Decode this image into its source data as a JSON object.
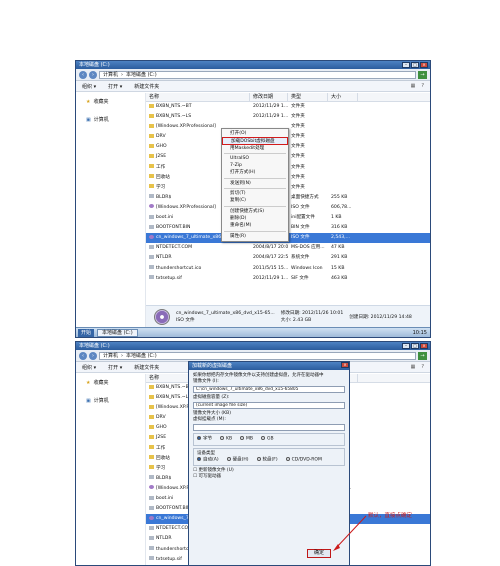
{
  "window": {
    "title": "本地磁盘 (C:)",
    "address": [
      "计算机",
      "本地磁盘 (C:)"
    ],
    "toolbar": [
      "组织 ▾",
      "打开 ▾",
      "新建文件夹"
    ],
    "sidebar": [
      "收藏夹",
      "计算机"
    ],
    "columns": [
      "名称",
      "修改日期",
      "类型",
      "大小"
    ]
  },
  "files": [
    {
      "name": "BXBN_NTS.~BT",
      "date": "2012/11/29 1...",
      "type": "文件夹",
      "size": "",
      "icon": "folder"
    },
    {
      "name": "BXBN_NTS.~LS",
      "date": "2012/11/29 1...",
      "type": "文件夹",
      "size": "",
      "icon": "folder"
    },
    {
      "name": "[Windows.XP.Professional]",
      "date": "",
      "type": "文件夹",
      "size": "",
      "icon": "folder"
    },
    {
      "name": "DRV",
      "date": "",
      "type": "文件夹",
      "size": "",
      "icon": "folder"
    },
    {
      "name": "GHO",
      "date": "",
      "type": "文件夹",
      "size": "",
      "icon": "folder"
    },
    {
      "name": "J2SE",
      "date": "",
      "type": "文件夹",
      "size": "",
      "icon": "folder"
    },
    {
      "name": "工作",
      "date": "",
      "type": "文件夹",
      "size": "",
      "icon": "folder"
    },
    {
      "name": "回收站",
      "date": "",
      "type": "文件夹",
      "size": "",
      "icon": "folder"
    },
    {
      "name": "学习",
      "date": "",
      "type": "文件夹",
      "size": "",
      "icon": "folder"
    },
    {
      "name": "BLDR$",
      "date": "",
      "type": "桌面快捷方式",
      "size": "255 KB",
      "icon": "file"
    },
    {
      "name": "[Windows.XP.Professional]",
      "date": "",
      "type": "ISO 文件",
      "size": "606,78...",
      "icon": "iso"
    },
    {
      "name": "boot.ini",
      "date": "",
      "type": "ini配置文件",
      "size": "1 KB",
      "icon": "file"
    },
    {
      "name": "BOOTFONT.BIN",
      "date": "",
      "type": "BIN 文件",
      "size": "316 KB",
      "icon": "file"
    },
    {
      "name": "cn_windows_7_ultimate_x86_dvd_x15-...",
      "date": "2012/11/26 10:01",
      "type": "ISO 文件",
      "size": "2,543,...",
      "icon": "iso",
      "selected": true
    },
    {
      "name": "NTDETECT.COM",
      "date": "2004/8/17 20:00",
      "type": "MS-DOS 应用...",
      "size": "47 KB",
      "icon": "file"
    },
    {
      "name": "NTLDR",
      "date": "2004/8/17 22:59",
      "type": "系统文件",
      "size": "291 KB",
      "icon": "file"
    },
    {
      "name": "thundershortcut.ico",
      "date": "2011/5/15 15...",
      "type": "Windows Icon",
      "size": "15 KB",
      "icon": "file"
    },
    {
      "name": "txtsetup.sif",
      "date": "2012/11/29 1...",
      "type": "SIF 文件",
      "size": "463 KB",
      "icon": "file"
    }
  ],
  "details": {
    "name": "cn_windows_7_ultimate_x86_dvd_x15-65...",
    "kind": "ISO 文件",
    "modified": "修改日期: 2012/11/26 10:01",
    "size": "大小: 2.43 GB",
    "created": "创建日期: 2012/11/29 14:48"
  },
  "taskbar": {
    "start": "开始",
    "task": "本地磁盘 (C:)",
    "clock": "10:15"
  },
  "context_menu": [
    "打开(O)",
    "加载DOSbit虚拟磁盘",
    "用Maskedit处理",
    "UltraISO",
    "7-Zip",
    "打开方式(H)",
    "发送到(N)",
    "剪切(T)",
    "复制(C)",
    "创建快捷方式(S)",
    "删除(D)",
    "重命名(M)",
    "属性(R)"
  ],
  "dialog": {
    "title": "加载新的虚拟磁盘",
    "desc": "如果你想把内存文件镜像文件以支持创建虚拟盘，允许在驱动器中",
    "image_label": "镜像文件 (I):",
    "image_value": "C:\\cn_windows_7_ultimate_x86_dvd_x15-65805",
    "size_label": "虚拟磁盘容量 (Z):",
    "size_value": "(current image file size)",
    "size_hint": "镜像文件大小 (KB)",
    "mount_label": "虚拟挂载点 (M):",
    "units": [
      "字节",
      "KB",
      "MB",
      "GB"
    ],
    "type_label": "设备类型",
    "types": [
      "自动(A)",
      "硬盘(H)",
      "软盘(F)",
      "CD/DVD-ROM"
    ],
    "opt1": "更新镜像文件 (U)",
    "opt2": "可写驱动器",
    "ok": "确定"
  },
  "note": "默认，直接点确定"
}
